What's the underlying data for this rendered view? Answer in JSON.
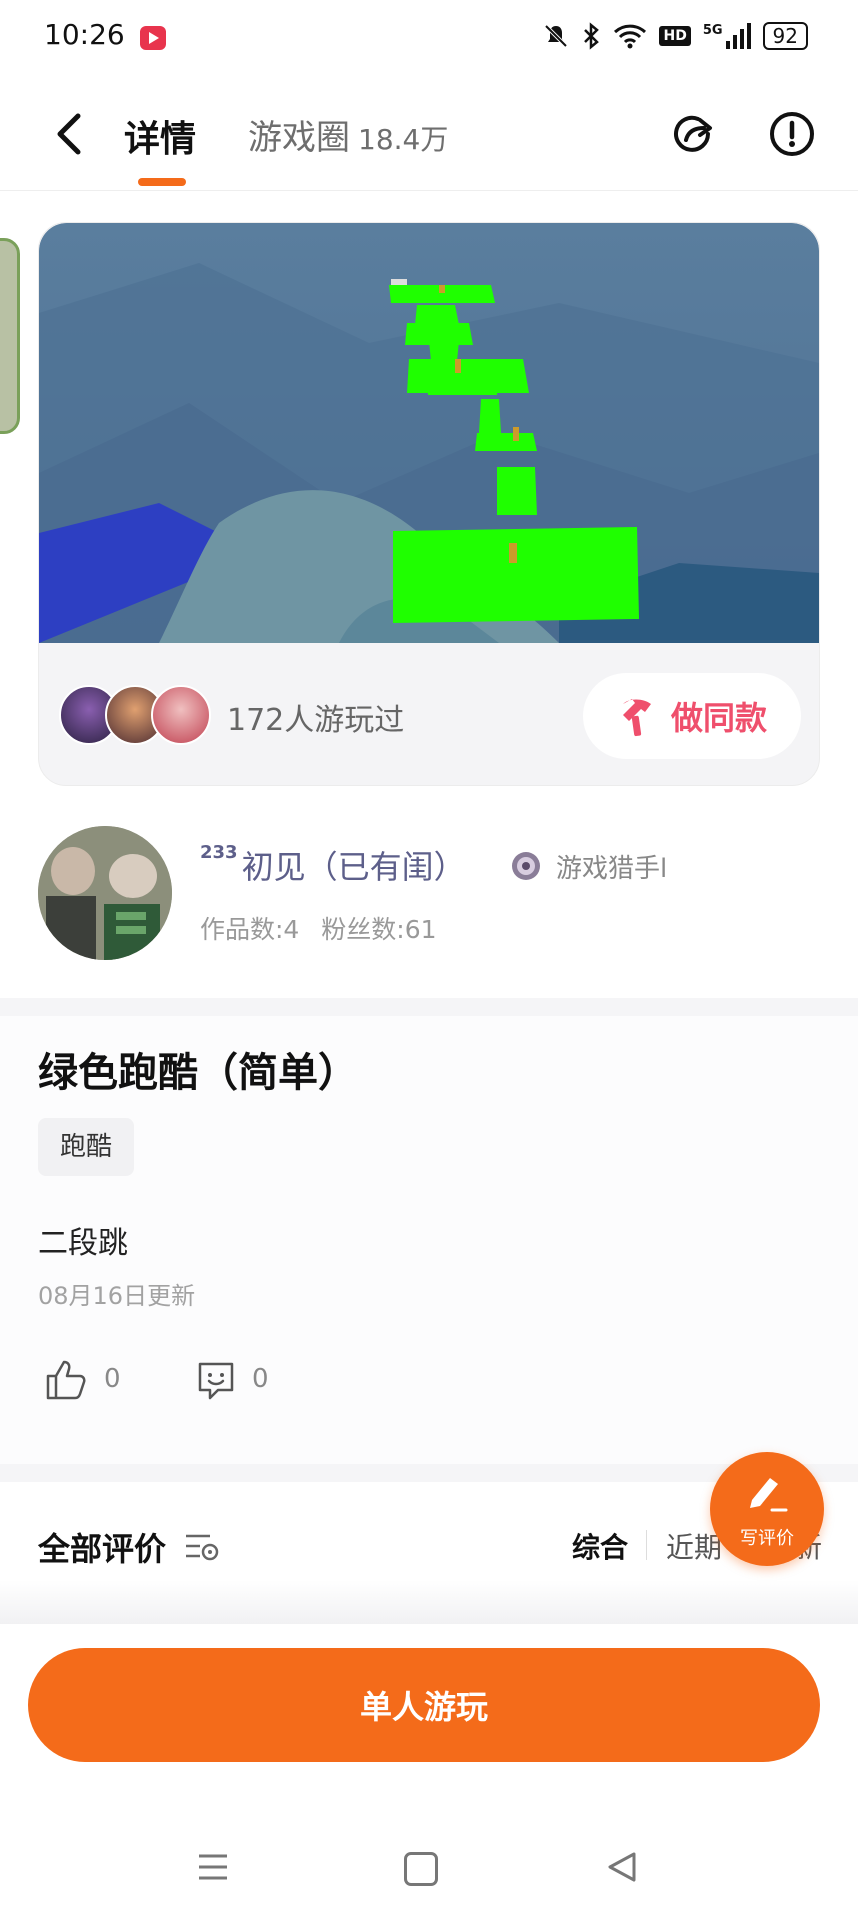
{
  "status_bar": {
    "time": "10:26",
    "icons": [
      "mute-bell-icon",
      "bluetooth-icon",
      "wifi-icon",
      "hd-icon",
      "5g-signal-icon"
    ],
    "hd_label": "HD",
    "network_label": "5G",
    "battery": "92"
  },
  "header": {
    "tabs": [
      {
        "label": "详情",
        "active": true
      },
      {
        "label": "游戏圈",
        "count": "18.4万",
        "active": false
      }
    ],
    "accent_color": "#f46b1a"
  },
  "game_card": {
    "played_text": "172人游玩过",
    "make_same_label": "做同款"
  },
  "author": {
    "level": "233",
    "name": "初见（已有闺）",
    "badge": "游戏猎手l",
    "works": "作品数:4",
    "fans": "粉丝数:61"
  },
  "game": {
    "title": "绿色跑酷（简单）",
    "tag": "跑酷",
    "description": "二段跳",
    "updated": "08月16日更新",
    "likes": "0",
    "comments": "0"
  },
  "reviews": {
    "title": "全部评价",
    "sort_options": [
      "综合",
      "近期",
      "新"
    ]
  },
  "fab": {
    "label": "写评价"
  },
  "bottom": {
    "play_label": "单人游玩"
  }
}
